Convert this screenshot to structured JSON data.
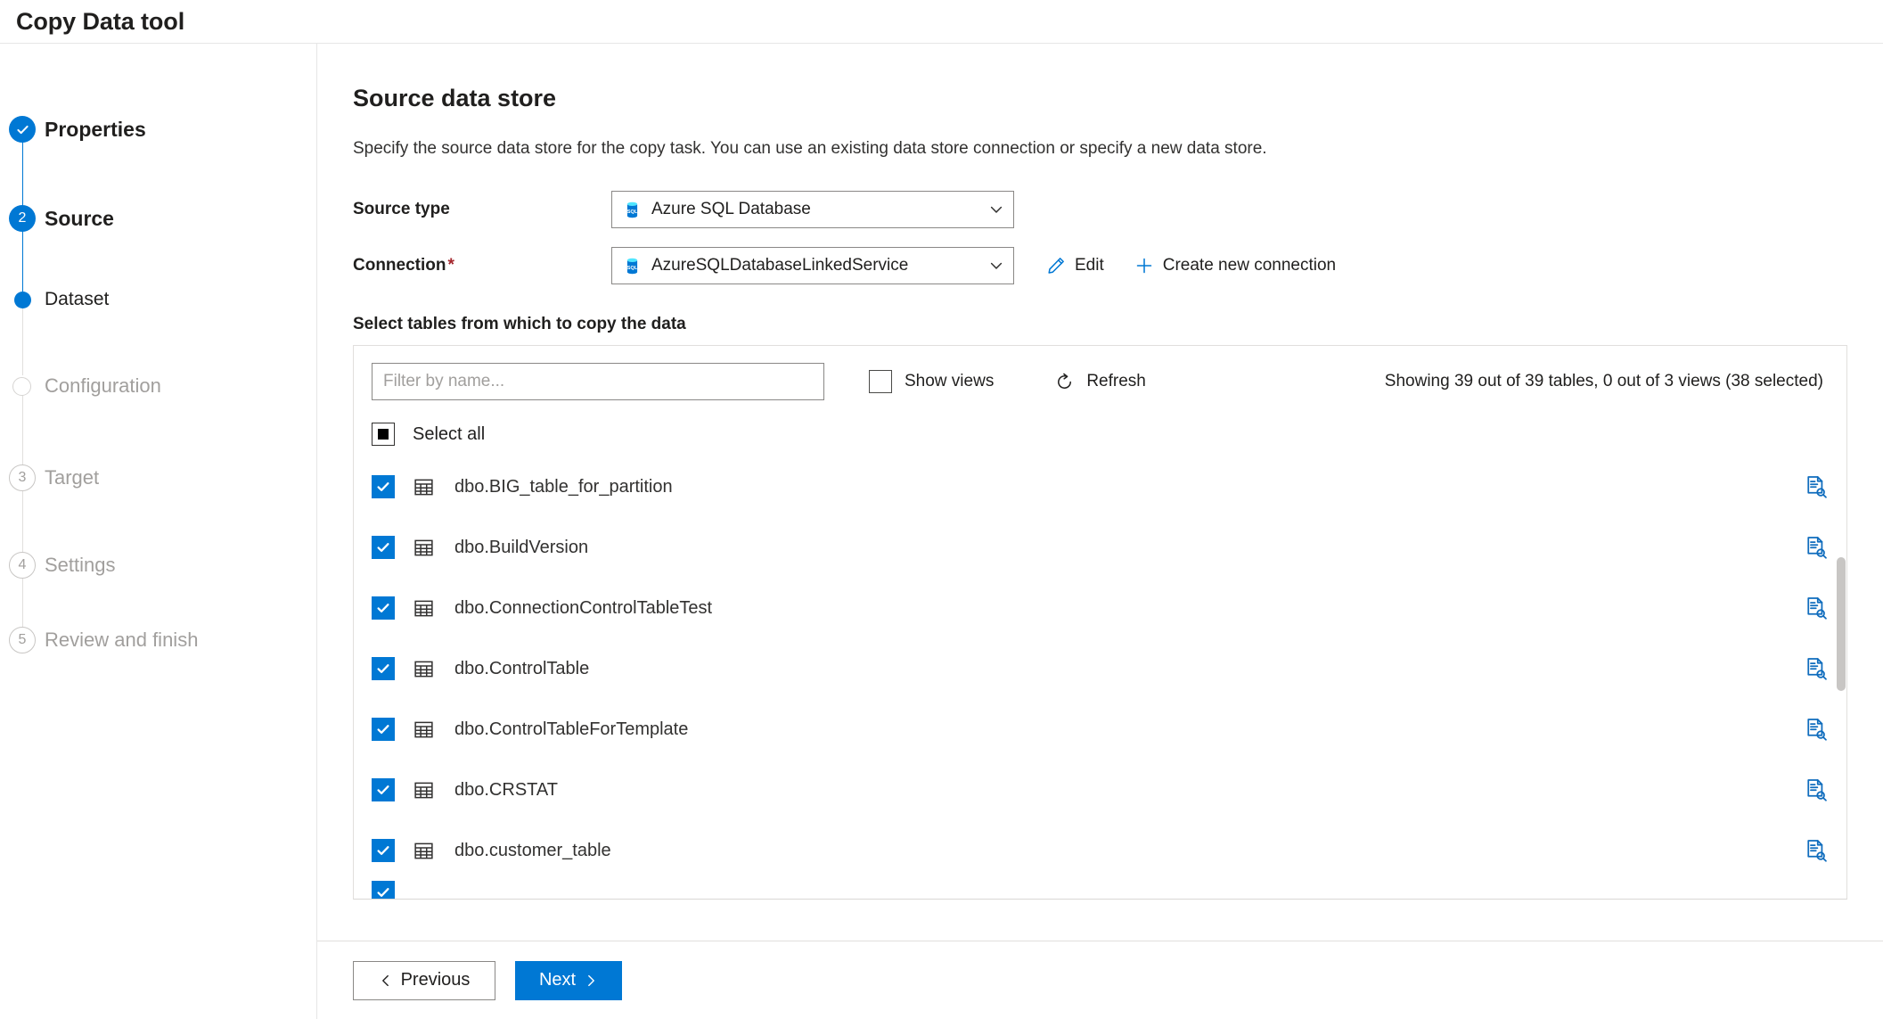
{
  "window": {
    "title": "Copy Data tool"
  },
  "wizard": {
    "steps": [
      {
        "label": "Properties",
        "marker": "check",
        "state": "done"
      },
      {
        "label": "Source",
        "marker": "2",
        "state": "current"
      },
      {
        "label": "Dataset",
        "marker": "dot",
        "state": "substep-active"
      },
      {
        "label": "Configuration",
        "marker": "",
        "state": "substep-future"
      },
      {
        "label": "Target",
        "marker": "3",
        "state": "future"
      },
      {
        "label": "Settings",
        "marker": "4",
        "state": "future"
      },
      {
        "label": "Review and finish",
        "marker": "5",
        "state": "future"
      }
    ]
  },
  "page": {
    "title": "Source data store",
    "description": "Specify the source data store for the copy task. You can use an existing data store connection or specify a new data store."
  },
  "form": {
    "source_type": {
      "label": "Source type",
      "value": "Azure SQL Database",
      "icon": "azure-sql-database-icon"
    },
    "connection": {
      "label": "Connection",
      "required_marker": "*",
      "value": "AzureSQLDatabaseLinkedService",
      "icon": "azure-sql-database-icon",
      "edit_label": "Edit",
      "edit_icon": "pencil-icon",
      "create_label": "Create new connection",
      "create_icon": "plus-icon"
    }
  },
  "picker": {
    "heading": "Select tables from which to copy the data",
    "filter_placeholder": "Filter by name...",
    "filter_value": "",
    "show_views_label": "Show views",
    "show_views_checked": false,
    "refresh_label": "Refresh",
    "refresh_icon": "refresh-icon",
    "status": "Showing 39 out of 39 tables, 0 out of 3 views (38 selected)",
    "select_all_label": "Select all",
    "select_all_state": "indeterminate",
    "rows": [
      {
        "name": "dbo.BIG_table_for_partition",
        "checked": true,
        "icon": "table-grid-icon",
        "preview_icon": "preview-data-icon"
      },
      {
        "name": "dbo.BuildVersion",
        "checked": true,
        "icon": "table-grid-icon",
        "preview_icon": "preview-data-icon"
      },
      {
        "name": "dbo.ConnectionControlTableTest",
        "checked": true,
        "icon": "table-grid-icon",
        "preview_icon": "preview-data-icon"
      },
      {
        "name": "dbo.ControlTable",
        "checked": true,
        "icon": "table-grid-icon",
        "preview_icon": "preview-data-icon"
      },
      {
        "name": "dbo.ControlTableForTemplate",
        "checked": true,
        "icon": "table-grid-icon",
        "preview_icon": "preview-data-icon"
      },
      {
        "name": "dbo.CRSTAT",
        "checked": true,
        "icon": "table-grid-icon",
        "preview_icon": "preview-data-icon"
      },
      {
        "name": "dbo.customer_table",
        "checked": true,
        "icon": "table-grid-icon",
        "preview_icon": "preview-data-icon"
      }
    ]
  },
  "footer": {
    "previous_label": "Previous",
    "next_label": "Next"
  },
  "colors": {
    "accent": "#0078d4",
    "required": "#a4262c",
    "preview_icon": "#0f6cbd",
    "muted_text": "#a19f9d"
  }
}
